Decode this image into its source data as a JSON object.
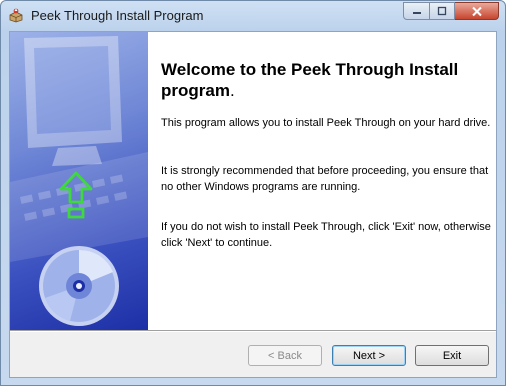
{
  "window": {
    "title": "Peek Through Install Program",
    "icons": {
      "app": "installer-box-icon",
      "minimize": "minimize-icon",
      "maximize": "maximize-icon",
      "close": "close-icon"
    }
  },
  "banner": {
    "icons": [
      "monitor-icon",
      "keyboard-icon",
      "up-arrow-icon",
      "cd-disc-icon"
    ]
  },
  "content": {
    "heading": "Welcome to the Peek Through Install program",
    "heading_end": ".",
    "paragraphs": [
      "This program allows you to install Peek Through on your hard drive.",
      "It is strongly recommended that before proceeding, you ensure that no other Windows programs are running.",
      "If you do not wish to install Peek Through, click 'Exit' now, otherwise click 'Next' to continue."
    ]
  },
  "buttons": {
    "back": "< Back",
    "next": "Next >",
    "exit": "Exit"
  },
  "colors": {
    "banner_top": "#9db2e8",
    "banner_bottom": "#1d2fa6",
    "arrow": "#3fd83f"
  }
}
